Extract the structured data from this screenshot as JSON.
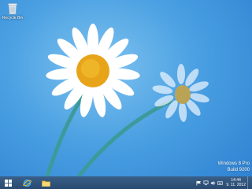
{
  "desktop": {
    "icons": [
      {
        "label": "Recycle Bin",
        "icon": "recycle-bin-icon"
      }
    ]
  },
  "watermark": {
    "edition": "Windows 8 Pro",
    "build": "Build 9200"
  },
  "taskbar": {
    "pinned": [
      {
        "name": "start-button",
        "icon": "windows-logo-icon"
      },
      {
        "name": "internet-explorer-button",
        "icon": "internet-explorer-icon"
      },
      {
        "name": "file-explorer-button",
        "icon": "folder-icon"
      }
    ],
    "tray_icons": [
      "flag-icon",
      "network-icon",
      "volume-icon",
      "keyboard-icon"
    ],
    "clock": {
      "time": "14:44",
      "date": "9. 11. 2012"
    }
  },
  "colors": {
    "sky_light": "#7fc3f0",
    "sky_dark": "#2c7fd0",
    "taskbar": "#2a4a70",
    "petal": "#ffffff",
    "flower_center": "#e8a419",
    "stem": "#3d9a9b"
  }
}
